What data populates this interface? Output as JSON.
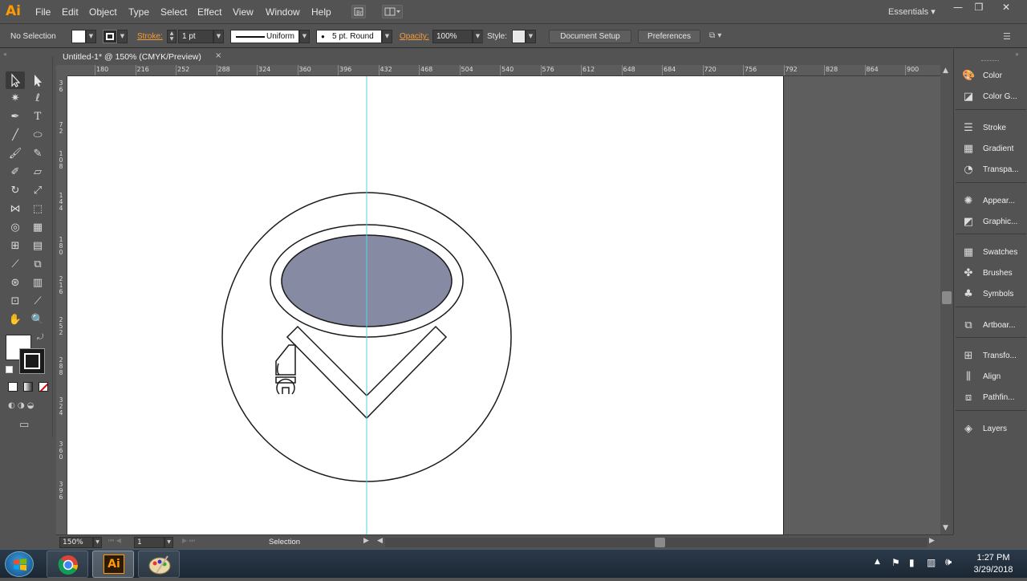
{
  "app": {
    "logo": "Ai",
    "menu": [
      "File",
      "Edit",
      "Object",
      "Type",
      "Select",
      "Effect",
      "View",
      "Window",
      "Help"
    ],
    "workspace": "Essentials",
    "window_controls": [
      "—",
      "❐",
      "✕"
    ]
  },
  "controlbar": {
    "selection": "No Selection",
    "stroke_label": "Stroke:",
    "stroke_weight": "1 pt",
    "stroke_profile": "Uniform",
    "brush": "5 pt. Round",
    "opacity_label": "Opacity:",
    "opacity_value": "100%",
    "style_label": "Style:",
    "document_setup": "Document Setup",
    "preferences": "Preferences"
  },
  "document": {
    "tab_title": "Untitled-1* @ 150% (CMYK/Preview)",
    "tab_close": "×"
  },
  "ruler": {
    "h_labels": [
      "180",
      "216",
      "252",
      "288",
      "324",
      "360",
      "396",
      "432",
      "468",
      "504",
      "540",
      "576",
      "612",
      "648",
      "684",
      "720",
      "756",
      "792",
      "828",
      "864",
      "900"
    ],
    "v_labels": [
      "3 6",
      "7 2",
      "1 0 8",
      "1 4 4",
      "1 8 0",
      "2 1 6",
      "2 5 2",
      "2 8 8",
      "3 2 4",
      "3 6 0",
      "3 9 6"
    ]
  },
  "artwork": {
    "fill_color": "#878aa3",
    "stroke_color": "#1a1a1a",
    "guide_color": "#4fd5e6"
  },
  "statusbar": {
    "zoom": "150%",
    "artboard_num": "1",
    "tool_name": "Selection"
  },
  "panels": [
    {
      "icon": "color-icon",
      "label": "Color"
    },
    {
      "icon": "color-guide-icon",
      "label": "Color G..."
    },
    {
      "icon": "stroke-icon",
      "label": "Stroke"
    },
    {
      "icon": "gradient-icon",
      "label": "Gradient"
    },
    {
      "icon": "transparency-icon",
      "label": "Transpa..."
    },
    {
      "icon": "appearance-icon",
      "label": "Appear..."
    },
    {
      "icon": "graphic-styles-icon",
      "label": "Graphic..."
    },
    {
      "icon": "swatches-icon",
      "label": "Swatches"
    },
    {
      "icon": "brushes-icon",
      "label": "Brushes"
    },
    {
      "icon": "symbols-icon",
      "label": "Symbols"
    },
    {
      "icon": "artboards-icon",
      "label": "Artboar..."
    },
    {
      "icon": "transform-icon",
      "label": "Transfo..."
    },
    {
      "icon": "align-icon",
      "label": "Align"
    },
    {
      "icon": "pathfinder-icon",
      "label": "Pathfin..."
    },
    {
      "icon": "layers-icon",
      "label": "Layers"
    }
  ],
  "taskbar": {
    "time": "1:27 PM",
    "date": "3/29/2018",
    "ai_label": "Ai"
  }
}
